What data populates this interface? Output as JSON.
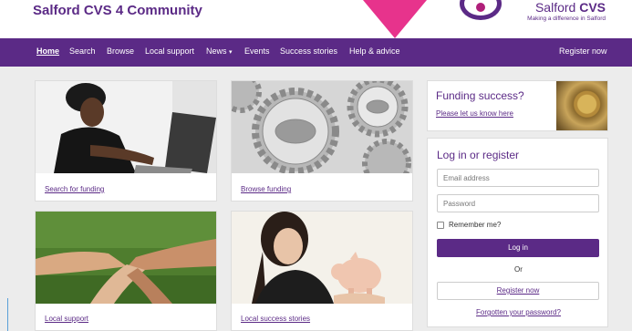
{
  "header": {
    "site_title": "Salford CVS 4 Community",
    "logo_name_prefix": "Salford ",
    "logo_name_bold": "CVS",
    "logo_tagline": "Making a difference in Salford"
  },
  "nav": {
    "items": [
      {
        "label": "Home",
        "active": true
      },
      {
        "label": "Search"
      },
      {
        "label": "Browse"
      },
      {
        "label": "Local support"
      },
      {
        "label": "News"
      },
      {
        "label": "Events"
      },
      {
        "label": "Success stories"
      },
      {
        "label": "Help & advice"
      }
    ],
    "news_caret": "▾",
    "register": "Register now"
  },
  "tiles": [
    {
      "link": "Search for funding"
    },
    {
      "link": "Browse funding"
    },
    {
      "link": "Local support"
    },
    {
      "link": "Local success stories"
    }
  ],
  "funding": {
    "title": "Funding success?",
    "link": "Please let us know here"
  },
  "login": {
    "title": "Log in or register",
    "email_placeholder": "Email address",
    "password_placeholder": "Password",
    "remember": "Remember me?",
    "login_button": "Log in",
    "or": "Or",
    "register_button": "Register now",
    "forgot": "Forgotten your password?"
  },
  "colors": {
    "brand_purple": "#5b2a86",
    "accent_pink": "#e7338c"
  }
}
